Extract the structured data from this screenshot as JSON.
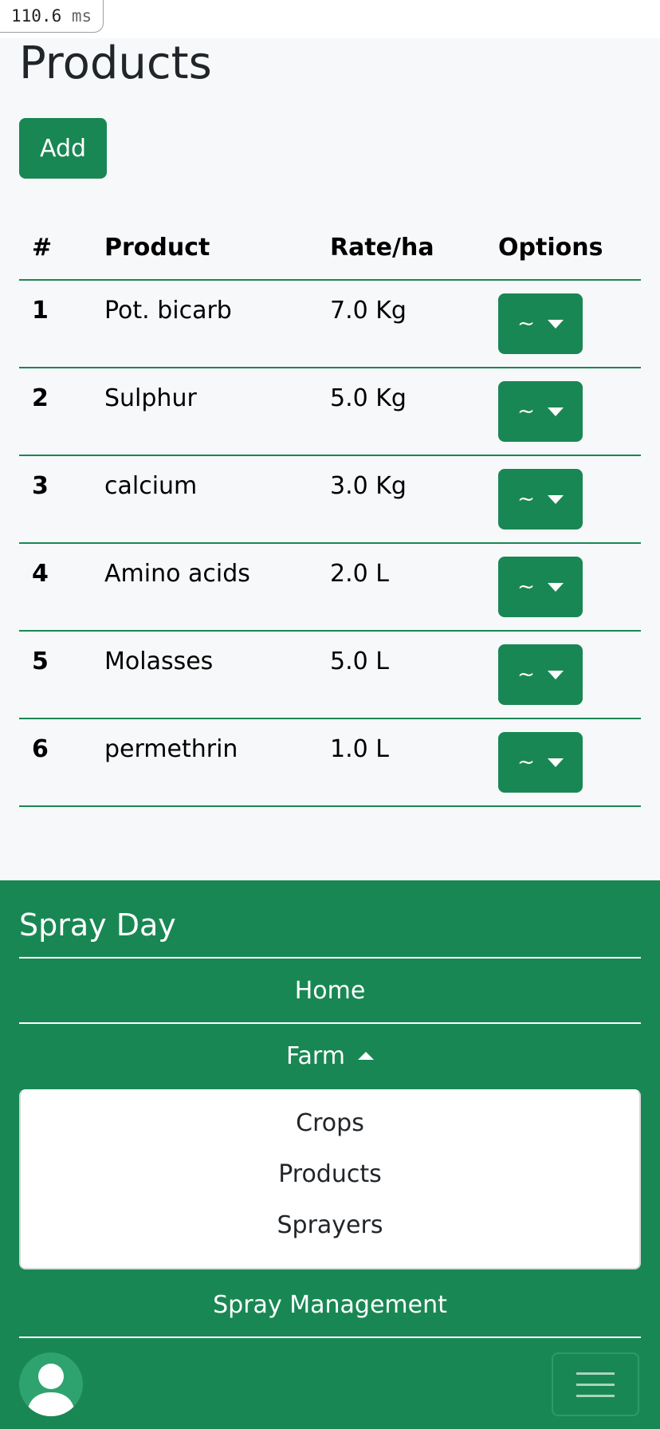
{
  "timing": {
    "value": "110.6",
    "unit": "ms"
  },
  "page": {
    "title": "Products",
    "add_label": "Add"
  },
  "table": {
    "headers": {
      "num": "#",
      "product": "Product",
      "rate": "Rate/ha",
      "options": "Options"
    },
    "option_button_label": "~",
    "rows": [
      {
        "num": "1",
        "product": "Pot. bicarb",
        "rate": "7.0 Kg"
      },
      {
        "num": "2",
        "product": "Sulphur",
        "rate": "5.0 Kg"
      },
      {
        "num": "3",
        "product": "calcium",
        "rate": "3.0 Kg"
      },
      {
        "num": "4",
        "product": "Amino acids",
        "rate": "2.0 L"
      },
      {
        "num": "5",
        "product": "Molasses",
        "rate": "5.0 L"
      },
      {
        "num": "6",
        "product": "permethrin",
        "rate": "1.0 L"
      }
    ]
  },
  "footer": {
    "brand": "Spray Day",
    "nav": {
      "home": "Home",
      "farm": "Farm",
      "farm_items": [
        "Crops",
        "Products",
        "Sprayers"
      ],
      "spray_management": "Spray Management"
    },
    "farm_expanded": true
  },
  "colors": {
    "accent": "#198754",
    "page_bg": "#f7f8fa"
  },
  "icons": {
    "caret": "caret-down-icon",
    "caret_up": "caret-up-icon",
    "avatar": "user-avatar-icon",
    "menu": "hamburger-menu-icon"
  }
}
